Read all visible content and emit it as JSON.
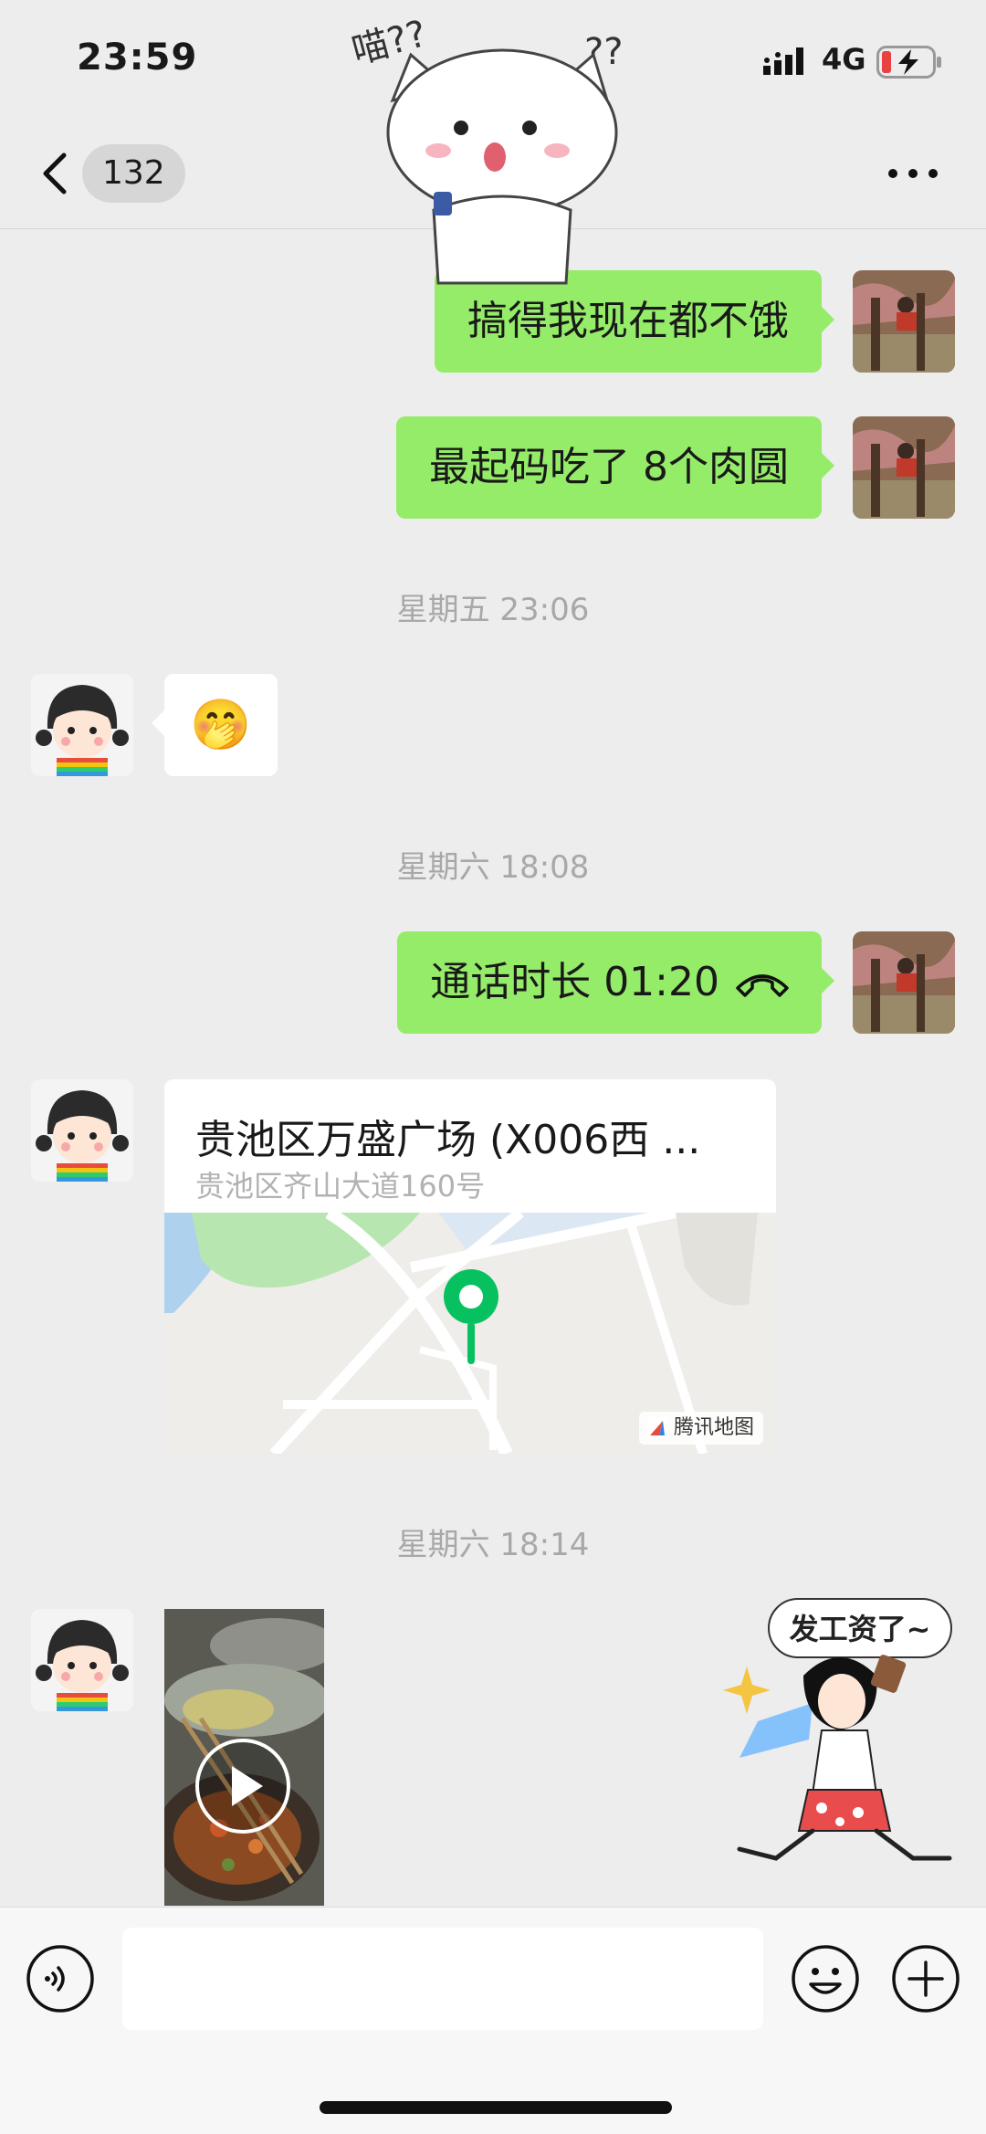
{
  "status_bar": {
    "time": "23:59",
    "network": "4G",
    "battery_state": "charging-low"
  },
  "nav": {
    "unread_count": "132"
  },
  "messages": [
    {
      "side": "out",
      "type": "text",
      "text": "搞得我现在都不饿"
    },
    {
      "side": "out",
      "type": "text",
      "text": "最起码吃了 8个肉圆"
    },
    {
      "type": "timestamp",
      "text": "星期五 23:06"
    },
    {
      "side": "in",
      "type": "emoji",
      "emoji": "🤭"
    },
    {
      "type": "timestamp",
      "text": "星期六 18:08"
    },
    {
      "side": "out",
      "type": "call",
      "text": "通话时长 01:20"
    },
    {
      "side": "in",
      "type": "location",
      "title": "贵池区万盛广场 (X006西 ...",
      "address": "贵池区齐山大道160号",
      "map_provider": "腾讯地图"
    },
    {
      "type": "timestamp",
      "text": "星期六 18:14"
    },
    {
      "side": "in",
      "type": "video"
    },
    {
      "side": "out",
      "type": "sticker",
      "sticker_text": "发工资了~"
    }
  ],
  "stickers": {
    "top_cat": "喵??"
  },
  "input": {
    "placeholder": ""
  },
  "colors": {
    "bubble_out": "#95ec69",
    "accent_green": "#07c160",
    "background": "#ededed"
  }
}
